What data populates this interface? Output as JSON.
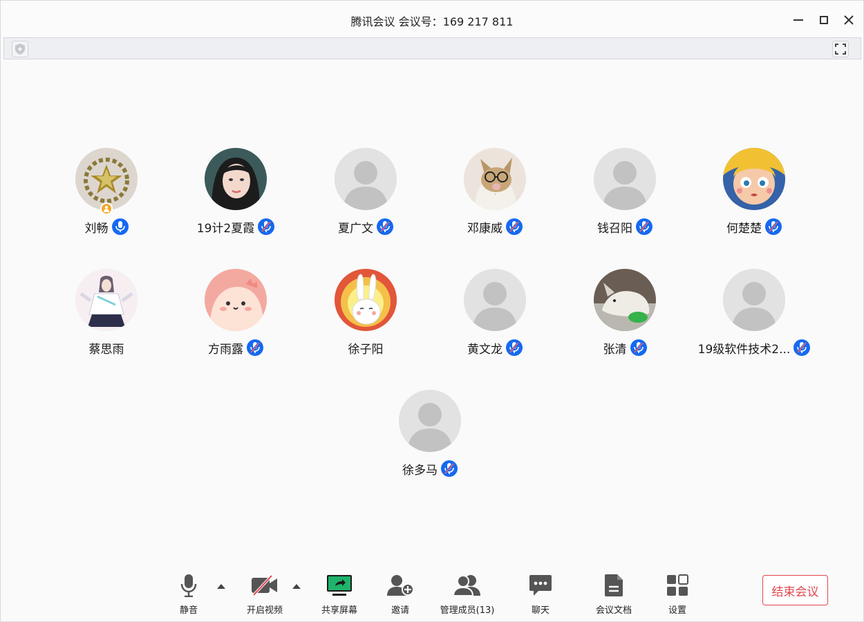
{
  "window": {
    "title": "腾讯会议 会议号：169 217 811"
  },
  "participants": [
    {
      "name": "刘畅",
      "avatar": "badge-emblem",
      "mic": "on",
      "host": true
    },
    {
      "name": "19计2夏霞",
      "avatar": "photo-girl",
      "mic": "muted"
    },
    {
      "name": "夏广文",
      "avatar": "default",
      "mic": "muted"
    },
    {
      "name": "邓康威",
      "avatar": "cat-glasses",
      "mic": "muted"
    },
    {
      "name": "钱召阳",
      "avatar": "default",
      "mic": "muted"
    },
    {
      "name": "何楚楚",
      "avatar": "cartoon-girl",
      "mic": "muted"
    },
    {
      "name": "蔡思雨",
      "avatar": "anime-girl",
      "mic": "none"
    },
    {
      "name": "方雨露",
      "avatar": "pink-blob",
      "mic": "muted"
    },
    {
      "name": "徐子阳",
      "avatar": "bunny",
      "mic": "none"
    },
    {
      "name": "黄文龙",
      "avatar": "default",
      "mic": "muted"
    },
    {
      "name": "张清",
      "avatar": "dog-photo",
      "mic": "muted"
    },
    {
      "name": "19级软件技术2...",
      "avatar": "default",
      "mic": "muted"
    },
    {
      "name": "徐多马",
      "avatar": "default",
      "mic": "muted"
    }
  ],
  "toolbar": {
    "mute_label": "静音",
    "video_label": "开启视频",
    "share_label": "共享屏幕",
    "invite_label": "邀请",
    "members_label": "管理成员(13)",
    "chat_label": "聊天",
    "docs_label": "会议文档",
    "settings_label": "设置",
    "end_label": "结束会议"
  },
  "colors": {
    "accent_blue": "#1669f0",
    "end_red": "#e0474f",
    "share_green": "#1fb36b",
    "host_orange": "#f5a623"
  }
}
